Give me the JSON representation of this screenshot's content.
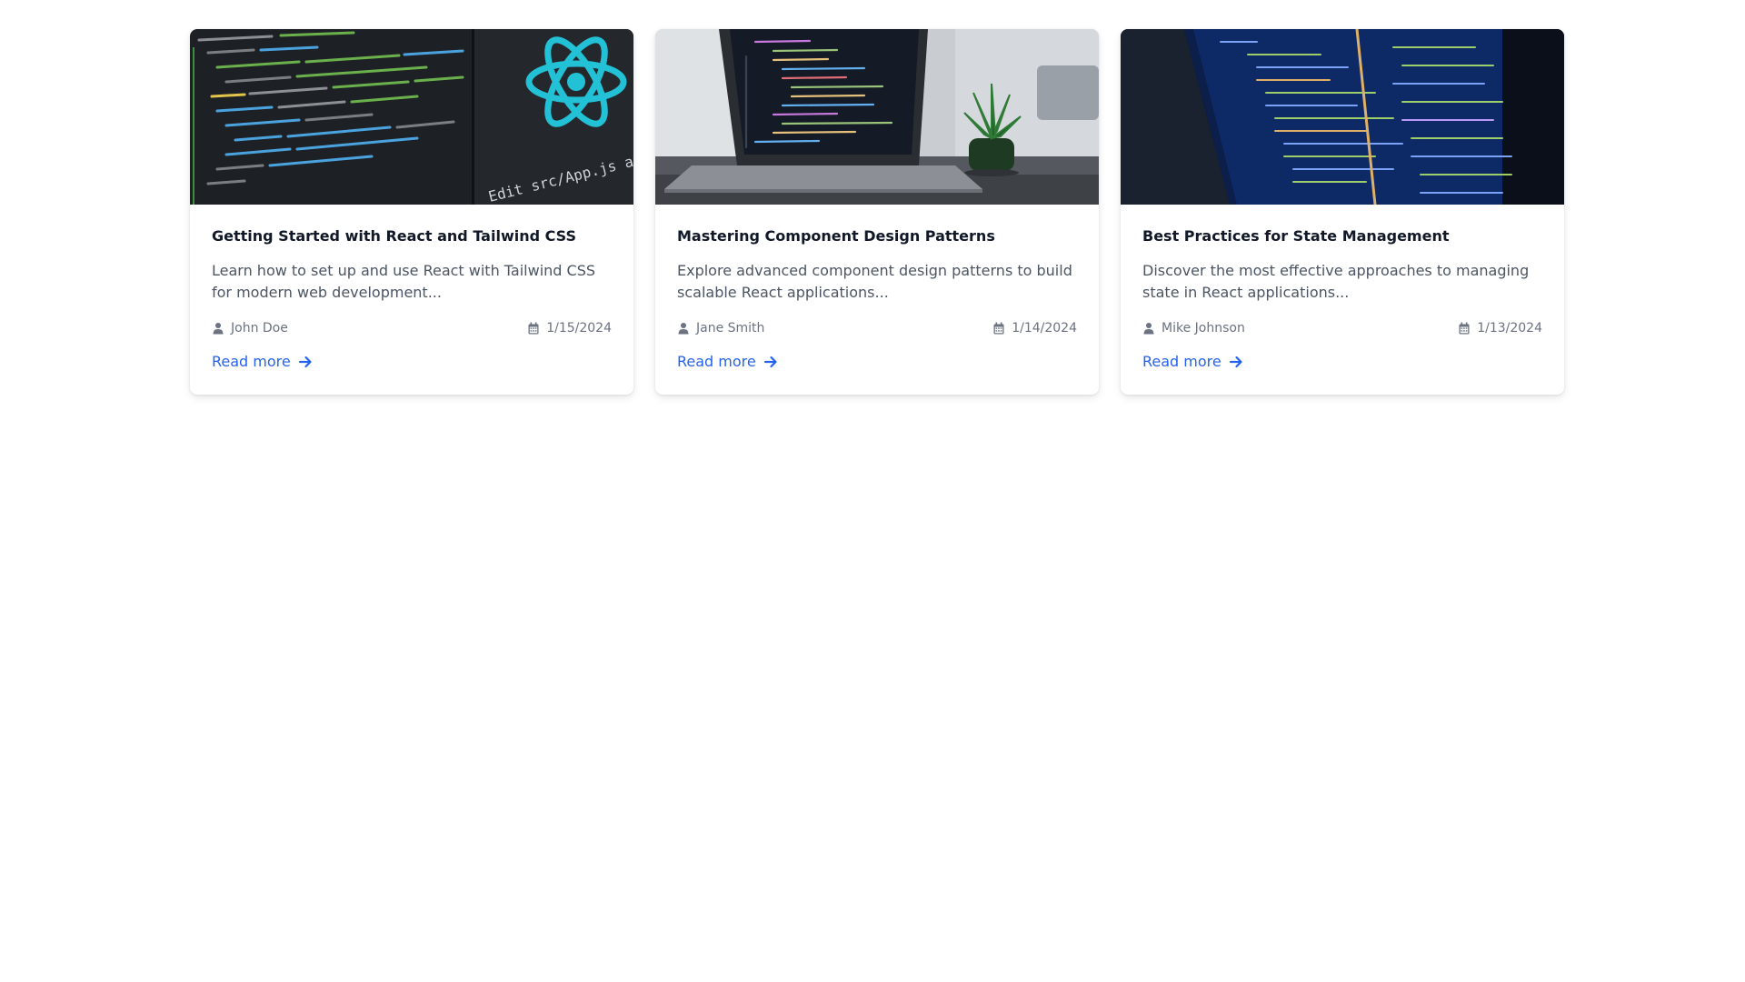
{
  "posts": [
    {
      "title": "Getting Started with React and Tailwind CSS",
      "excerpt": "Learn how to set up and use React with Tailwind CSS for modern web development...",
      "author": "John Doe",
      "date": "1/15/2024",
      "read_more": "Read more",
      "image_caption": "Edit src/App.js and save to reload"
    },
    {
      "title": "Mastering Component Design Patterns",
      "excerpt": "Explore advanced component design patterns to build scalable React applications...",
      "author": "Jane Smith",
      "date": "1/14/2024",
      "read_more": "Read more"
    },
    {
      "title": "Best Practices for State Management",
      "excerpt": "Discover the most effective approaches to managing state in React applications...",
      "author": "Mike Johnson",
      "date": "1/13/2024",
      "read_more": "Read more"
    }
  ],
  "icons": {
    "author": "user-icon",
    "date": "calendar-icon",
    "read_more": "arrow-right-icon"
  },
  "colors": {
    "title": "#111827",
    "excerpt": "#4b5563",
    "meta": "#6b7280",
    "link": "#2563eb",
    "react_logo": "#22c1d6"
  }
}
